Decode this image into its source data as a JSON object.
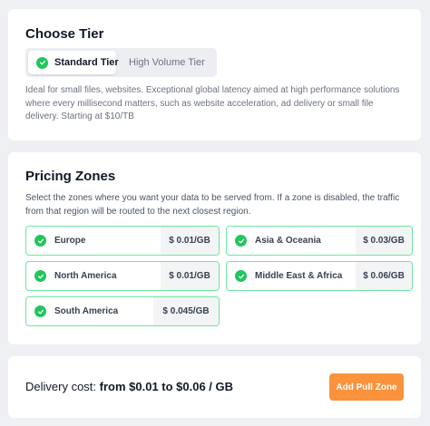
{
  "tier_card": {
    "title": "Choose Tier",
    "options": [
      {
        "label": "Standard Tier",
        "selected": true
      },
      {
        "label": "High Volume Tier",
        "selected": false
      }
    ],
    "description": "Ideal for small files, websites. Exceptional global latency aimed at high performance solutions where every millisecond matters, such as website acceleration, ad delivery or small file delivery. Starting at $10/TB"
  },
  "zones_card": {
    "title": "Pricing Zones",
    "description": "Select the zones where you want your data to be served from. If a zone is disabled, the traffic from that region will be routed to the next closest region.",
    "zones": [
      {
        "name": "Europe",
        "price": "$ 0.01/GB",
        "enabled": true
      },
      {
        "name": "Asia & Oceania",
        "price": "$ 0.03/GB",
        "enabled": true
      },
      {
        "name": "North America",
        "price": "$ 0.01/GB",
        "enabled": true
      },
      {
        "name": "Middle East & Africa",
        "price": "$ 0.06/GB",
        "enabled": true
      },
      {
        "name": "South America",
        "price": "$ 0.045/GB",
        "enabled": true
      }
    ]
  },
  "delivery": {
    "label": "Delivery cost: ",
    "range": "from $0.01 to $0.06 / GB",
    "button_label": "Add Pull Zone"
  },
  "colors": {
    "accent_check": "#22c55e",
    "zone_border": "#6ee7a0",
    "button": "#fb923c"
  },
  "icons": {
    "check": "check-circle-icon"
  }
}
